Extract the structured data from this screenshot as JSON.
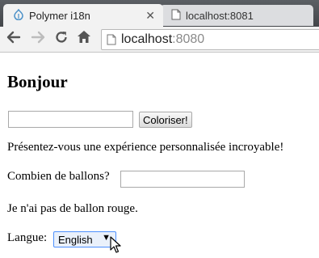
{
  "browser": {
    "tabs": [
      {
        "title": "Polymer i18n",
        "active": true
      },
      {
        "title": "localhost:8081",
        "active": false
      }
    ],
    "address": {
      "host": "localhost",
      "port": ":8080"
    },
    "icons": {
      "tab1": "polymer-logo-icon",
      "tab2": "page-icon",
      "back": "back-arrow-icon",
      "forward": "forward-arrow-icon",
      "reload": "reload-icon",
      "home": "home-icon",
      "page": "page-icon"
    }
  },
  "page": {
    "heading": "Bonjour",
    "color_input": {
      "value": ""
    },
    "colorize_button": "Coloriser!",
    "intro_text": "Présentez-vous une expérience personnalisée incroyable!",
    "balloons_label": "Combien de ballons?",
    "balloons_input": {
      "value": ""
    },
    "balloon_status": "Je n'ai pas de ballon rouge.",
    "language_label": "Langue:",
    "language_select": {
      "selected": "English"
    }
  },
  "colors": {
    "focus_border": "#4d90fe",
    "tab_strip": "#4a4d52"
  }
}
